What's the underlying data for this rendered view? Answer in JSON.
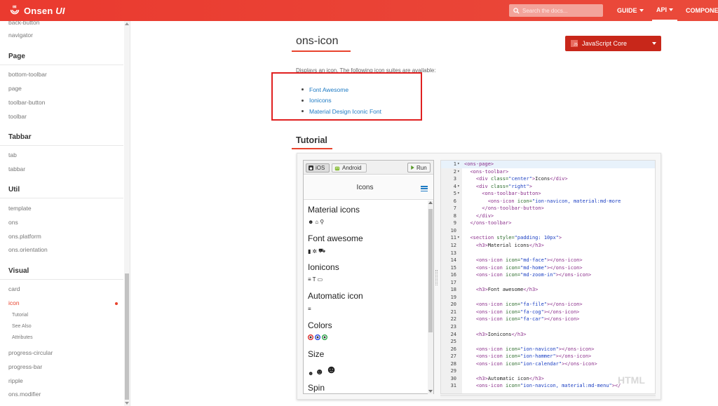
{
  "topbar": {
    "logo_text": "Onsen",
    "logo_text_italic": "UI",
    "search_placeholder": "Search the docs...",
    "nav": [
      {
        "label": "GUIDE"
      },
      {
        "label": "API"
      },
      {
        "label": "COMPONE"
      }
    ],
    "color": "#ea3a2f"
  },
  "sidebar": {
    "top_partial": "back-button",
    "navigator": "navigator",
    "sections": [
      {
        "title": "Page",
        "items": [
          "bottom-toolbar",
          "page",
          "toolbar-button",
          "toolbar"
        ]
      },
      {
        "title": "Tabbar",
        "items": [
          "tab",
          "tabbar"
        ]
      },
      {
        "title": "Util",
        "items": [
          "template",
          "ons",
          "ons.platform",
          "ons.orientation"
        ]
      },
      {
        "title": "Visual",
        "items": [
          "card",
          "icon",
          "progress-circular",
          "progress-bar",
          "ripple",
          "ons.modifier"
        ]
      }
    ],
    "sub_items": [
      "Tutorial",
      "See Also",
      "Attributes"
    ],
    "active_item": "icon",
    "active_color": "#e8432d"
  },
  "main": {
    "title": "ons-icon",
    "language_selector": "JavaScript Core",
    "language_icon_text": "JS",
    "description": "Displays an icon. The following icon suites are available:",
    "suites": [
      "Font Awesome",
      "Ionicons",
      "Material Design Iconic Font"
    ],
    "tutorial_title": "Tutorial"
  },
  "preview": {
    "ios_label": "iOS",
    "android_label": "Android",
    "run_label": "Run",
    "toolbar_title": "Icons",
    "headings": [
      "Material icons",
      "Font awesome",
      "Ionicons",
      "Automatic icon",
      "Colors",
      "Size",
      "Spin"
    ],
    "material_icons": [
      "☻",
      "⌂",
      "⚲"
    ],
    "fa_icons": [
      "▮",
      "✲",
      "⛟"
    ],
    "ion_icons": [
      "≡",
      "T",
      "▭"
    ],
    "auto_icon": "≡",
    "size_icons": [
      "☻",
      "☻",
      "☻"
    ]
  },
  "editor": {
    "watermark": "HTML",
    "lines": [
      {
        "n": "1",
        "fold": "▾",
        "html": "<span class=\"tag\">&lt;ons-page&gt;</span>"
      },
      {
        "n": "2",
        "fold": "▾",
        "html": "  <span class=\"tag\">&lt;ons-toolbar&gt;</span>"
      },
      {
        "n": "3",
        "fold": "",
        "html": "    <span class=\"tag\">&lt;div</span> <span class=\"attr\">class=</span><span class=\"str\">\"center\"</span><span class=\"tag\">&gt;</span>Icons<span class=\"tag\">&lt;/div&gt;</span>"
      },
      {
        "n": "4",
        "fold": "▾",
        "html": "    <span class=\"tag\">&lt;div</span> <span class=\"attr\">class=</span><span class=\"str\">\"right\"</span><span class=\"tag\">&gt;</span>"
      },
      {
        "n": "5",
        "fold": "▾",
        "html": "      <span class=\"tag\">&lt;ons-toolbar-button&gt;</span>"
      },
      {
        "n": "6",
        "fold": "",
        "html": "        <span class=\"tag\">&lt;ons-icon</span> <span class=\"attr\">icon=</span><span class=\"str\">\"ion-navicon, material:md-more</span>"
      },
      {
        "n": "7",
        "fold": "",
        "html": "      <span class=\"tag\">&lt;/ons-toolbar-button&gt;</span>"
      },
      {
        "n": "8",
        "fold": "",
        "html": "    <span class=\"tag\">&lt;/div&gt;</span>"
      },
      {
        "n": "9",
        "fold": "",
        "html": "  <span class=\"tag\">&lt;/ons-toolbar&gt;</span>"
      },
      {
        "n": "10",
        "fold": "",
        "html": ""
      },
      {
        "n": "11",
        "fold": "▾",
        "html": "  <span class=\"tag\">&lt;section</span> <span class=\"attr\">style=</span><span class=\"str\">\"padding: 10px\"</span><span class=\"tag\">&gt;</span>"
      },
      {
        "n": "12",
        "fold": "",
        "html": "    <span class=\"tag\">&lt;h3&gt;</span>Material icons<span class=\"tag\">&lt;/h3&gt;</span>"
      },
      {
        "n": "13",
        "fold": "",
        "html": ""
      },
      {
        "n": "14",
        "fold": "",
        "html": "    <span class=\"tag\">&lt;ons-icon</span> <span class=\"attr\">icon=</span><span class=\"str\">\"md-face\"</span><span class=\"tag\">&gt;&lt;/ons-icon&gt;</span>"
      },
      {
        "n": "15",
        "fold": "",
        "html": "    <span class=\"tag\">&lt;ons-icon</span> <span class=\"attr\">icon=</span><span class=\"str\">\"md-home\"</span><span class=\"tag\">&gt;&lt;/ons-icon&gt;</span>"
      },
      {
        "n": "16",
        "fold": "",
        "html": "    <span class=\"tag\">&lt;ons-icon</span> <span class=\"attr\">icon=</span><span class=\"str\">\"md-zoom-in\"</span><span class=\"tag\">&gt;&lt;/ons-icon&gt;</span>"
      },
      {
        "n": "17",
        "fold": "",
        "html": ""
      },
      {
        "n": "18",
        "fold": "",
        "html": "    <span class=\"tag\">&lt;h3&gt;</span>Font awesome<span class=\"tag\">&lt;/h3&gt;</span>"
      },
      {
        "n": "19",
        "fold": "",
        "html": ""
      },
      {
        "n": "20",
        "fold": "",
        "html": "    <span class=\"tag\">&lt;ons-icon</span> <span class=\"attr\">icon=</span><span class=\"str\">\"fa-file\"</span><span class=\"tag\">&gt;&lt;/ons-icon&gt;</span>"
      },
      {
        "n": "21",
        "fold": "",
        "html": "    <span class=\"tag\">&lt;ons-icon</span> <span class=\"attr\">icon=</span><span class=\"str\">\"fa-cog\"</span><span class=\"tag\">&gt;&lt;/ons-icon&gt;</span>"
      },
      {
        "n": "22",
        "fold": "",
        "html": "    <span class=\"tag\">&lt;ons-icon</span> <span class=\"attr\">icon=</span><span class=\"str\">\"fa-car\"</span><span class=\"tag\">&gt;&lt;/ons-icon&gt;</span>"
      },
      {
        "n": "23",
        "fold": "",
        "html": ""
      },
      {
        "n": "24",
        "fold": "",
        "html": "    <span class=\"tag\">&lt;h3&gt;</span>Ionicons<span class=\"tag\">&lt;/h3&gt;</span>"
      },
      {
        "n": "25",
        "fold": "",
        "html": ""
      },
      {
        "n": "26",
        "fold": "",
        "html": "    <span class=\"tag\">&lt;ons-icon</span> <span class=\"attr\">icon=</span><span class=\"str\">\"ion-navicon\"</span><span class=\"tag\">&gt;&lt;/ons-icon&gt;</span>"
      },
      {
        "n": "27",
        "fold": "",
        "html": "    <span class=\"tag\">&lt;ons-icon</span> <span class=\"attr\">icon=</span><span class=\"str\">\"ion-hammer\"</span><span class=\"tag\">&gt;&lt;/ons-icon&gt;</span>"
      },
      {
        "n": "28",
        "fold": "",
        "html": "    <span class=\"tag\">&lt;ons-icon</span> <span class=\"attr\">icon=</span><span class=\"str\">\"ion-calendar\"</span><span class=\"tag\">&gt;&lt;/ons-icon&gt;</span>"
      },
      {
        "n": "29",
        "fold": "",
        "html": ""
      },
      {
        "n": "30",
        "fold": "",
        "html": "    <span class=\"tag\">&lt;h3&gt;</span>Automatic icon<span class=\"tag\">&lt;/h3&gt;</span>"
      },
      {
        "n": "31",
        "fold": "",
        "html": "    <span class=\"tag\">&lt;ons-icon</span> <span class=\"attr\">icon=</span><span class=\"str\">\"ion-navicon, material:md-menu\"</span><span class=\"tag\">&gt;&lt;/</span>"
      }
    ]
  }
}
